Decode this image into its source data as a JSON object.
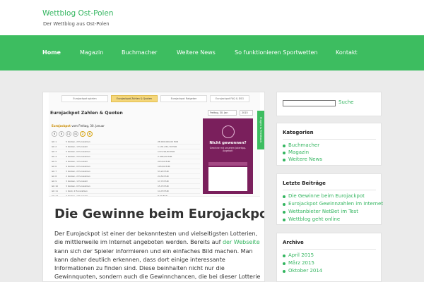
{
  "header": {
    "site_title": "Wettblog Ost-Polen",
    "tagline": "Der Wettblog aus Ost-Polen"
  },
  "nav": {
    "items": [
      {
        "label": "Home",
        "active": true
      },
      {
        "label": "Magazin"
      },
      {
        "label": "Buchmacher"
      },
      {
        "label": "Weitere News"
      },
      {
        "label": "So funktionieren Sportwetten"
      },
      {
        "label": "Kontakt"
      }
    ]
  },
  "article": {
    "thumbnail": {
      "tabs": [
        "Eurojackpot spielen",
        "Eurojackpot Zahlen & Quoten",
        "Eurojackpot Ratgeber",
        "Eurojackpot FAQ & DSG"
      ],
      "title": "Eurojackpot Zahlen & Quoten",
      "date_select": "Freitag, 30. Jan",
      "year_select": "2015",
      "draw_label_bold": "Eurojackpot",
      "draw_label_rest": " vom Freitag, 30. Januar",
      "numbers": [
        "6",
        "8",
        "11",
        "41",
        "2",
        "6"
      ],
      "rows": [
        {
          "klass": "GK 1",
          "desc": "5 Zahlen, 2 Eurozahlen",
          "win": "28.000.000,00 EUR"
        },
        {
          "klass": "GK 2",
          "desc": "5 Zahlen, 1 Eurozahl",
          "win": "1.131.451,70 EUR"
        },
        {
          "klass": "GK 3",
          "desc": "5 Zahlen, 0 Eurozahlen",
          "win": "172.291,80 EUR"
        },
        {
          "klass": "GK 4",
          "desc": "4 Zahlen, 2 Eurozahlen",
          "win": "2.446,00 EUR"
        },
        {
          "klass": "GK 5",
          "desc": "4 Zahlen, 1 Eurozahl",
          "win": "215,60 EUR"
        },
        {
          "klass": "GK 6",
          "desc": "4 Zahlen, 0 Eurozahlen",
          "win": "105,80 EUR"
        },
        {
          "klass": "GK 7",
          "desc": "3 Zahlen, 2 Eurozahlen",
          "win": "53,20 EUR"
        },
        {
          "klass": "GK 8",
          "desc": "2 Zahlen, 2 Eurozahlen",
          "win": "24,50 EUR"
        },
        {
          "klass": "GK 9",
          "desc": "3 Zahlen, 1 Eurozahl",
          "win": "17,70 EUR"
        },
        {
          "klass": "GK 10",
          "desc": "3 Zahlen, 0 Eurozahlen",
          "win": "15,70 EUR"
        },
        {
          "klass": "GK 11",
          "desc": "1 Zahl, 2 Eurozahlen",
          "win": "14,70 EUR"
        },
        {
          "klass": "GK 12",
          "desc": "2 Zahlen, 1 Eurozahl",
          "win": "8,50 EUR"
        }
      ],
      "promo_title": "Nicht gewonnen?",
      "promo_text": "Gewinne mit unserem Jokertipp-Angebot!",
      "feedback": "Fragen & Feedback"
    },
    "title": "Die Gewinne beim Eurojackpot",
    "body": {
      "line1": "Der Eurojackpot ist einer der bekanntesten und vielseitigsten Lotterien,",
      "line2_pre": "die mittlerweile im Internet angeboten werden. Bereits auf ",
      "line2_link": "der Webseite",
      "line3": "kann sich der Spieler informieren und ein einfaches Bild machen. Man",
      "line4": "kann daher deutlich erkennen, dass dort einige interessante",
      "line5": "Informationen zu finden sind. Diese beinhalten nicht nur die",
      "line6": "Gewinnquoten, sondern auch die Gewinnchancen, die bei dieser Lotterie"
    }
  },
  "sidebar": {
    "search_button": "Suche",
    "categories": {
      "title": "Kategorien",
      "items": [
        "Buchmacher",
        "Magazin",
        "Weitere News"
      ]
    },
    "recent_posts": {
      "title": "Letzte Beiträge",
      "items": [
        "Die Gewinne beim Eurojackpot",
        "Eurojackpot Gewinnzahlen im Internet",
        "Wettanbieter NetBet im Test",
        "Wettblog geht online"
      ]
    },
    "archive": {
      "title": "Archive",
      "items": [
        "April 2015",
        "März 2015",
        "Oktober 2014"
      ]
    }
  },
  "colors": {
    "accent": "#3dbd60",
    "link": "#33b55f",
    "background": "#ebebeb"
  }
}
